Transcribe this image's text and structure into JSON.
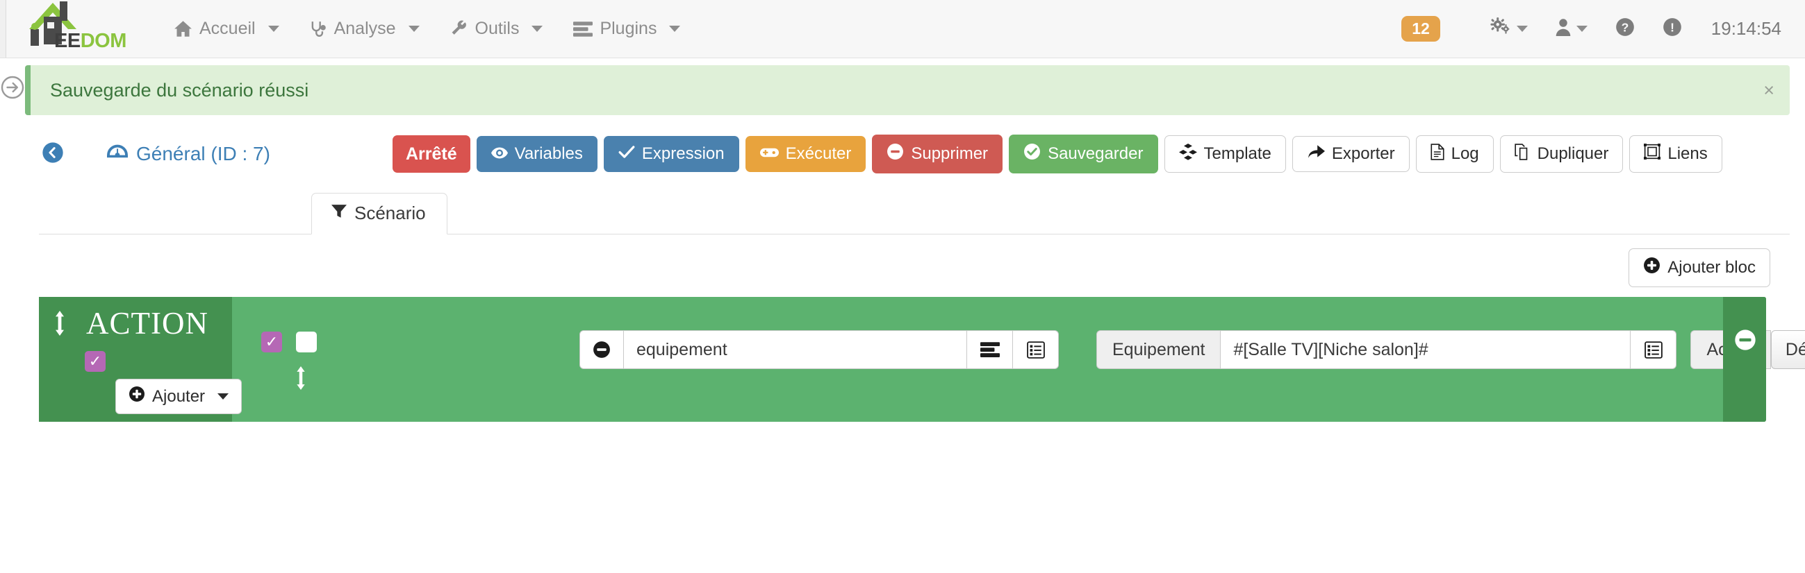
{
  "navbar": {
    "brand": {
      "ee": "EE",
      "dom": "DOM",
      "logo_icon": "jeedom-house-logo"
    },
    "menu": [
      {
        "label": "Accueil",
        "icon": "home-icon"
      },
      {
        "label": "Analyse",
        "icon": "stethoscope-icon"
      },
      {
        "label": "Outils",
        "icon": "wrench-icon"
      },
      {
        "label": "Plugins",
        "icon": "server-icon"
      }
    ],
    "badge_count": "12",
    "badge_color": "#e5a34b",
    "right_icons": [
      {
        "name": "gears-icon"
      },
      {
        "name": "user-icon"
      },
      {
        "name": "question-circle-icon"
      },
      {
        "name": "exclamation-circle-icon"
      }
    ],
    "time": "19:14:54"
  },
  "alert": {
    "message": "Sauvegarde du scénario réussi",
    "close_label": "×",
    "text_color": "#3c763d",
    "bg_color": "#dff0d8",
    "side_icon": "arrow-circle-right-icon"
  },
  "toolbar": {
    "back_icon": "arrow-circle-left-icon",
    "title": "Général (ID : 7)",
    "title_icon": "dashboard-icon",
    "buttons": [
      {
        "label": "Arrêté",
        "icon": "",
        "style": "btn-state"
      },
      {
        "label": "Variables",
        "icon": "eye-icon",
        "style": "btn-blue"
      },
      {
        "label": "Expression",
        "icon": "check-icon",
        "style": "btn-blue"
      },
      {
        "label": "Exécuter",
        "icon": "gamepad-icon",
        "style": "btn-orange"
      },
      {
        "label": "Supprimer",
        "icon": "minus-circle-icon",
        "style": "btn-red"
      },
      {
        "label": "Sauvegarder",
        "icon": "check-circle-icon",
        "style": "btn-green"
      },
      {
        "label": "Template",
        "icon": "cubes-icon",
        "style": "btn-default"
      },
      {
        "label": "Exporter",
        "icon": "share-icon",
        "style": "btn-default"
      },
      {
        "label": "Log",
        "icon": "file-text-icon",
        "style": "btn-default"
      },
      {
        "label": "Dupliquer",
        "icon": "copy-icon",
        "style": "btn-default"
      },
      {
        "label": "Liens",
        "icon": "object-group-icon",
        "style": "btn-default"
      }
    ]
  },
  "tabs": [
    {
      "label": "Scénario",
      "icon": "filter-icon",
      "active": true
    }
  ],
  "add_block": {
    "label": "Ajouter bloc",
    "icon": "plus-circle-icon"
  },
  "action_block": {
    "title": "ACTION",
    "panel_color": "#449150",
    "body_color": "#5cb26f",
    "drag_icon": "vertical-drag-handle-icon",
    "enabled_checkbox": {
      "checked": true,
      "color": "#b568b5"
    },
    "add_button": {
      "label": "Ajouter",
      "icon": "plus-circle-icon"
    },
    "row_checkbox_checked": {
      "checked": true,
      "color": "#b568b5"
    },
    "row_checkbox_unchecked": {
      "checked": false
    },
    "equipement_row": {
      "remove_icon": "minus-circle-icon",
      "name_value": "equipement",
      "name_placeholder": "equipement",
      "btn1_icon": "server-icon",
      "btn2_icon": "list-alt-icon"
    },
    "action_row": {
      "label": "Equipement",
      "value": "#[Salle TV][Niche salon]#",
      "picker_icon": "list-alt-icon",
      "action_label": "Action",
      "action_selected": "Désactiver",
      "action_options": [
        "Désactiver"
      ],
      "remove_icon": "minus-circle-icon"
    }
  }
}
